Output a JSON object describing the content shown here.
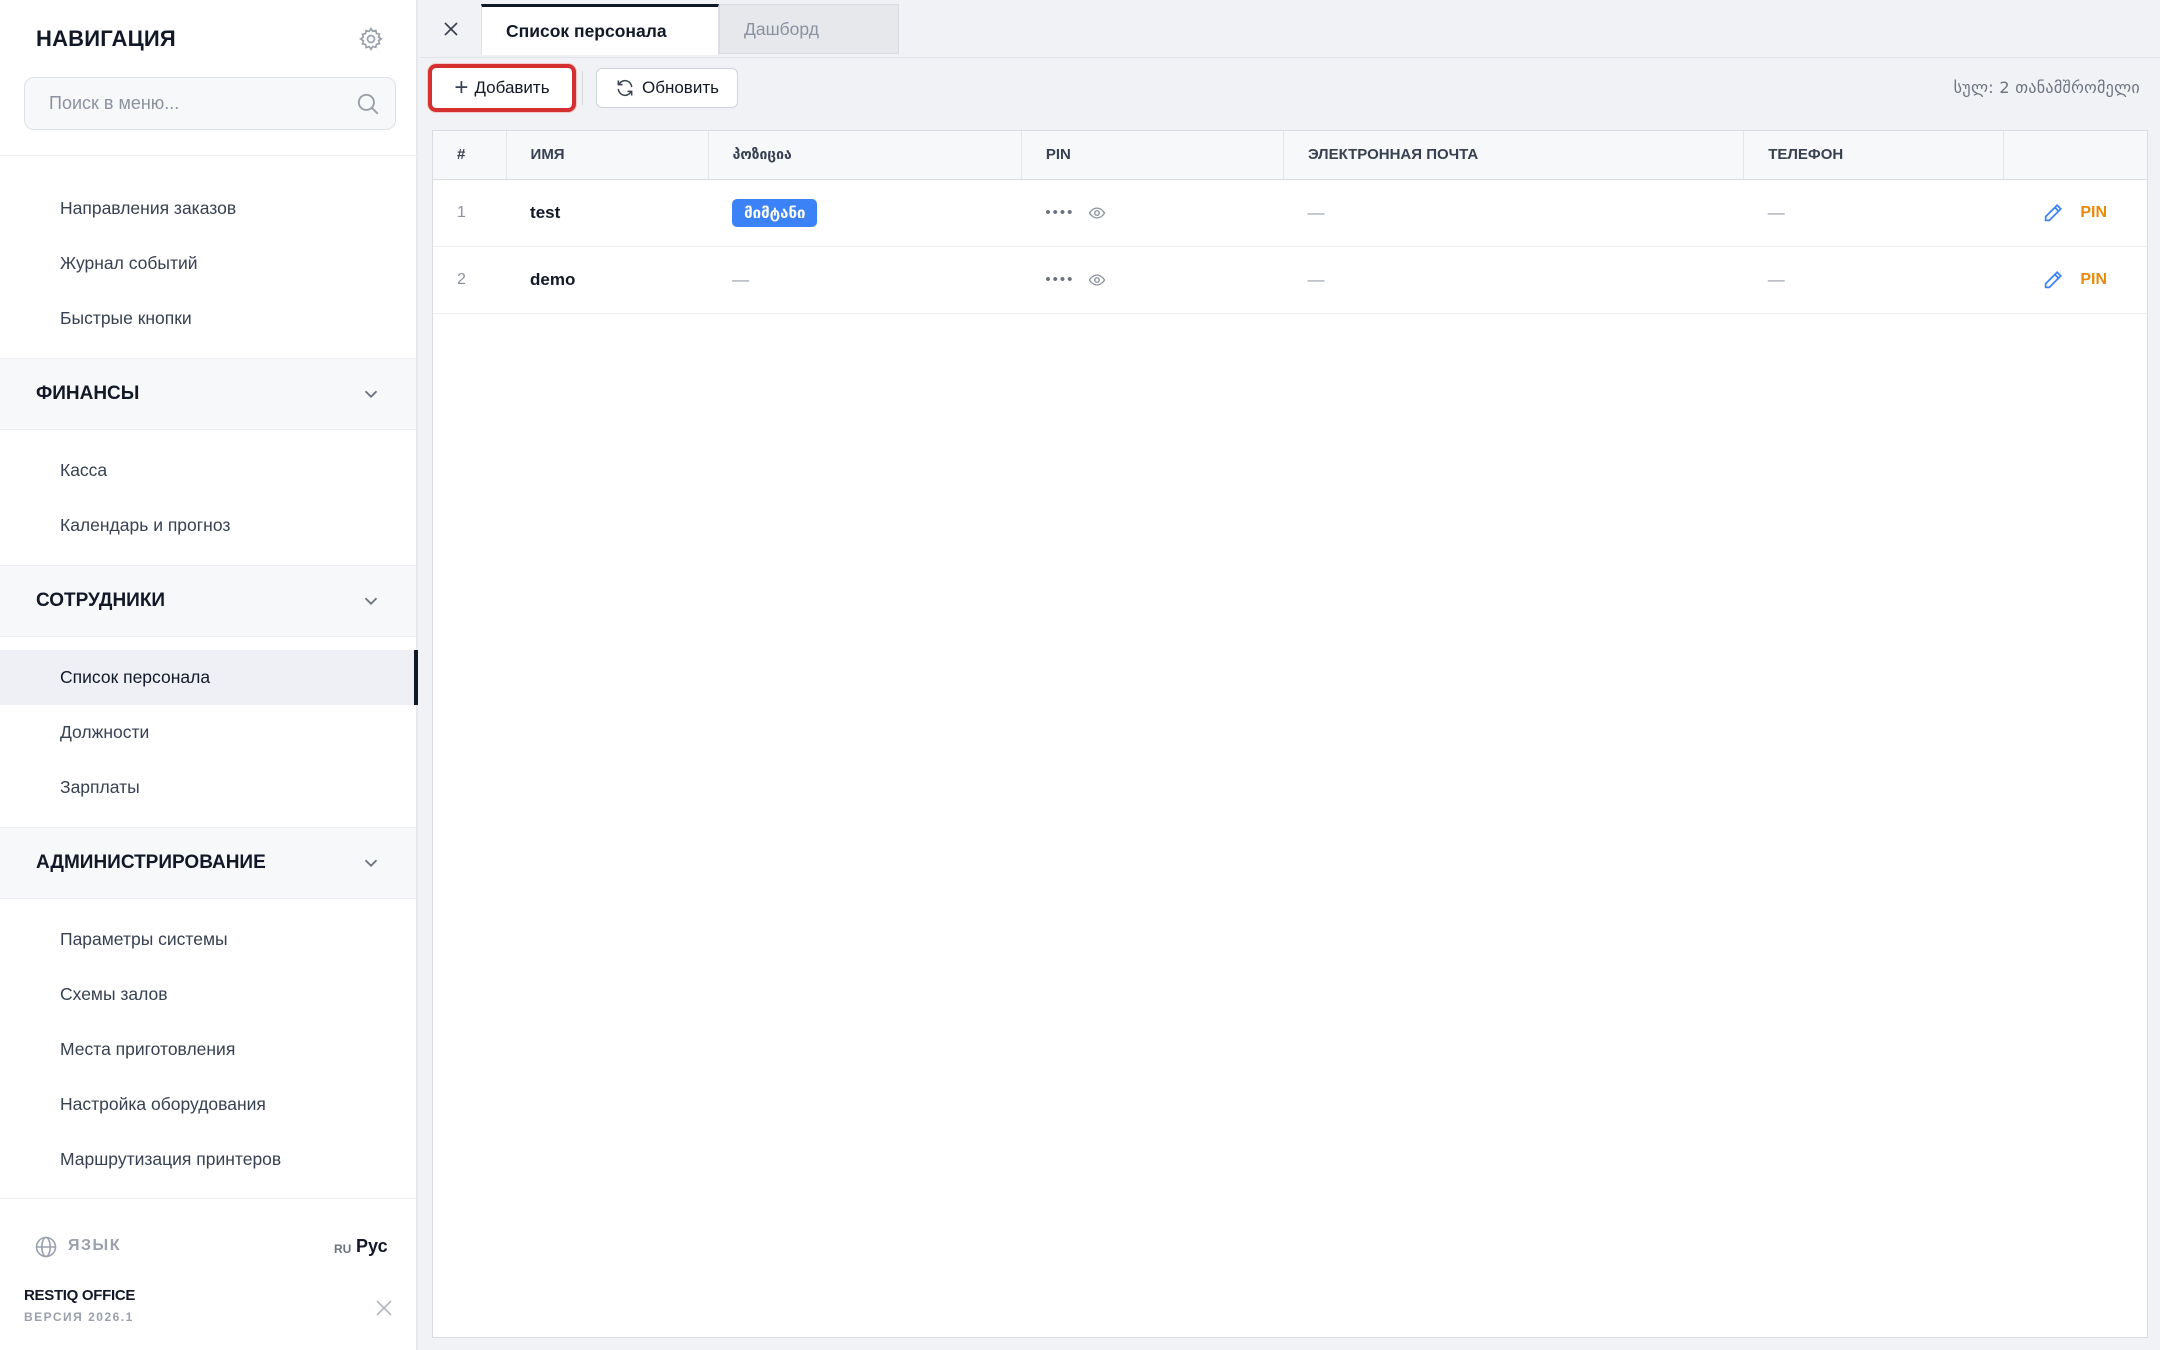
{
  "sidebar": {
    "title": "НАВИГАЦИЯ",
    "search_placeholder": "Поиск в меню...",
    "items_top": [
      "Направления заказов",
      "Журнал событий",
      "Быстрые кнопки"
    ],
    "finance": {
      "title": "ФИНАНСЫ",
      "items": [
        "Касса",
        "Календарь и прогноз"
      ]
    },
    "staff": {
      "title": "СОТРУДНИКИ",
      "items": [
        "Список персонала",
        "Должности",
        "Зарплаты"
      ]
    },
    "admin": {
      "title": "АДМИНИСТРИРОВАНИЕ",
      "items": [
        "Параметры системы",
        "Схемы залов",
        "Места приготовления",
        "Настройка оборудования",
        "Маршрутизация принтеров"
      ]
    },
    "language_label": "ЯЗЫК",
    "language_code": "RU",
    "language_value": "Рус",
    "brand": "RESTIQ OFFICE",
    "version": "ВЕРСИЯ 2026.1"
  },
  "tabs": [
    {
      "label": "Список персонала",
      "active": true
    },
    {
      "label": "Дашборд",
      "active": false
    }
  ],
  "toolbar": {
    "add_label": "Добавить",
    "refresh_label": "Обновить",
    "total_text": "სულ: 2 თანამშრომელი"
  },
  "table": {
    "headers": [
      "#",
      "ИМЯ",
      "პოზიცია",
      "PIN",
      "ЭЛЕКТРОННАЯ ПОЧТА",
      "ТЕЛЕФОН",
      ""
    ],
    "rows": [
      {
        "num": "1",
        "name": "test",
        "position": "მიმტანი",
        "pin": "••••",
        "email": "—",
        "phone": "—",
        "pin_action": "PIN"
      },
      {
        "num": "2",
        "name": "demo",
        "position": "—",
        "pin": "••••",
        "email": "—",
        "phone": "—",
        "pin_action": "PIN"
      }
    ]
  },
  "icons": {
    "gear": "gear-icon",
    "search": "search-icon",
    "chevron": "chevron-down-icon",
    "globe": "globe-icon",
    "close": "close-icon",
    "plus": "plus-icon",
    "refresh": "refresh-icon",
    "eye": "eye-icon",
    "edit": "pencil-icon"
  },
  "colors": {
    "accent_blue": "#3b82f6",
    "pin_orange": "#ea8a0c",
    "highlight_red": "#d62f2f",
    "active_bar": "#111827"
  }
}
